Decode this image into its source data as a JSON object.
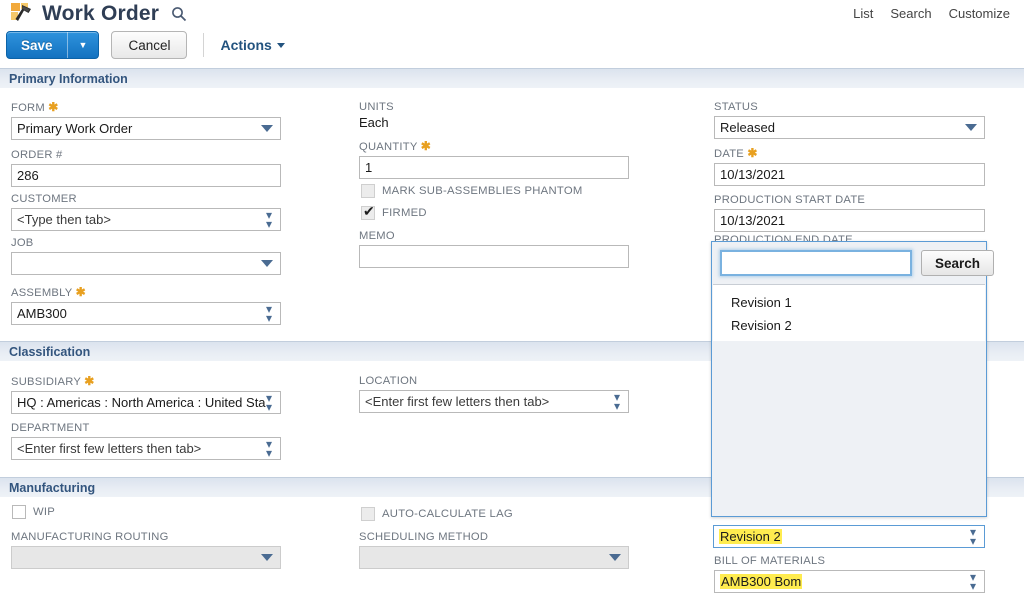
{
  "header": {
    "title": "Work Order",
    "title_icon": "hammer-icon",
    "search_icon": "search-icon",
    "nav": [
      "List",
      "Search",
      "Customize"
    ],
    "save_label": "Save",
    "save_caret_icon": "caret-down-icon",
    "cancel_label": "Cancel",
    "actions_label": "Actions",
    "actions_caret_icon": "caret-down-icon"
  },
  "sections": {
    "primary": "Primary Information",
    "classification": "Classification",
    "manufacturing": "Manufacturing"
  },
  "primary": {
    "form": {
      "label": "FORM",
      "required": true,
      "value": "Primary Work Order",
      "control": "dropdown"
    },
    "order_no": {
      "label": "ORDER #",
      "required": false,
      "value": "286",
      "control": "text"
    },
    "customer": {
      "label": "CUSTOMER",
      "required": false,
      "value": "<Type then tab>",
      "control": "lookup"
    },
    "job": {
      "label": "JOB",
      "required": false,
      "value": "",
      "control": "dropdown"
    },
    "assembly": {
      "label": "ASSEMBLY",
      "required": true,
      "value": "AMB300",
      "control": "lookup"
    },
    "units": {
      "label": "UNITS",
      "value": "Each",
      "control": "static"
    },
    "quantity": {
      "label": "QUANTITY",
      "required": true,
      "value": "1",
      "control": "text"
    },
    "mark_phantom": {
      "label": "MARK SUB-ASSEMBLIES PHANTOM",
      "checked": false
    },
    "firmed": {
      "label": "FIRMED",
      "checked": true
    },
    "memo": {
      "label": "MEMO",
      "value": "",
      "control": "text"
    },
    "status": {
      "label": "STATUS",
      "required": false,
      "value": "Released",
      "control": "dropdown"
    },
    "date": {
      "label": "DATE",
      "required": true,
      "value": "10/13/2021",
      "control": "text"
    },
    "production_start_date": {
      "label": "PRODUCTION START DATE",
      "value": "10/13/2021",
      "control": "text"
    },
    "production_end_date": {
      "label": "PRODUCTION END DATE",
      "value": "",
      "control": "text"
    },
    "revision": {
      "label": "",
      "value": "Revision 2",
      "control": "lookup",
      "highlighted": true
    },
    "bill_of_materials": {
      "label": "BILL OF MATERIALS",
      "value": "AMB300 Bom",
      "control": "lookup",
      "highlighted": true
    }
  },
  "classification": {
    "subsidiary": {
      "label": "SUBSIDIARY",
      "required": true,
      "value": "HQ : Americas : North America : United Sta",
      "control": "lookup"
    },
    "department": {
      "label": "DEPARTMENT",
      "required": false,
      "value": "<Enter first few letters then tab>",
      "control": "lookup"
    },
    "location": {
      "label": "LOCATION",
      "required": false,
      "value": "<Enter first few letters then tab>",
      "control": "lookup"
    }
  },
  "manufacturing": {
    "wip": {
      "label": "WIP",
      "checked": false
    },
    "manufacturing_routing": {
      "label": "MANUFACTURING ROUTING",
      "value": "",
      "control": "dropdown",
      "disabled": true
    },
    "auto_calculate_lag": {
      "label": "AUTO-CALCULATE LAG",
      "checked": false,
      "disabled": true
    },
    "scheduling_method": {
      "label": "SCHEDULING METHOD",
      "value": "",
      "control": "dropdown",
      "disabled": true
    }
  },
  "popup": {
    "search_value": "",
    "search_placeholder": "",
    "search_button": "Search",
    "options": [
      "Revision 1",
      "Revision 2"
    ]
  },
  "colors": {
    "accent_blue": "#1372c0",
    "section_header_text": "#33557e",
    "highlight_yellow": "#ffec4f",
    "required_star": "#e8a020",
    "popup_border": "#5b9bd5"
  }
}
